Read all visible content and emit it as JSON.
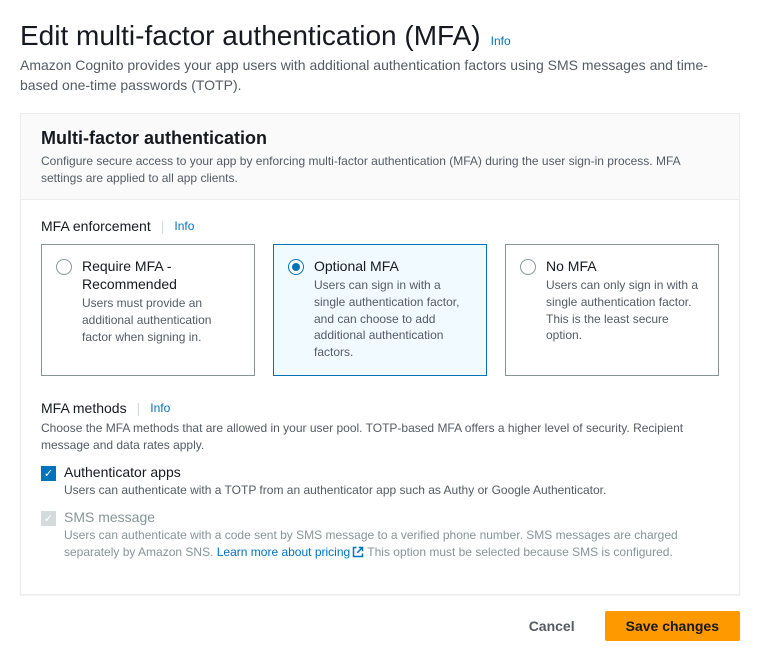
{
  "page": {
    "title": "Edit multi-factor authentication (MFA)",
    "info": "Info",
    "description": "Amazon Cognito provides your app users with additional authentication factors using SMS messages and time-based one-time passwords (TOTP)."
  },
  "panel": {
    "title": "Multi-factor authentication",
    "description": "Configure secure access to your app by enforcing multi-factor authentication (MFA) during the user sign-in process. MFA settings are applied to all app clients."
  },
  "enforcement": {
    "label": "MFA enforcement",
    "info": "Info",
    "selected": "optional",
    "options": [
      {
        "id": "require",
        "title": "Require MFA - Recommended",
        "desc": "Users must provide an additional authentication factor when signing in."
      },
      {
        "id": "optional",
        "title": "Optional MFA",
        "desc": "Users can sign in with a single authentication factor, and can choose to add additional authentication factors."
      },
      {
        "id": "none",
        "title": "No MFA",
        "desc": "Users can only sign in with a single authentication factor. This is the least secure option."
      }
    ]
  },
  "methods": {
    "label": "MFA methods",
    "info": "Info",
    "description": "Choose the MFA methods that are allowed in your user pool. TOTP-based MFA offers a higher level of security. Recipient message and data rates apply.",
    "authenticator": {
      "title": "Authenticator apps",
      "desc": "Users can authenticate with a TOTP from an authenticator app such as Authy or Google Authenticator.",
      "checked": true
    },
    "sms": {
      "title": "SMS message",
      "desc_pre": "Users can authenticate with a code sent by SMS message to a verified phone number. SMS messages are charged separately by Amazon SNS. ",
      "link": "Learn more about pricing",
      "desc_post": " This option must be selected because SMS is configured.",
      "checked": true,
      "disabled": true
    }
  },
  "footer": {
    "cancel": "Cancel",
    "save": "Save changes"
  }
}
